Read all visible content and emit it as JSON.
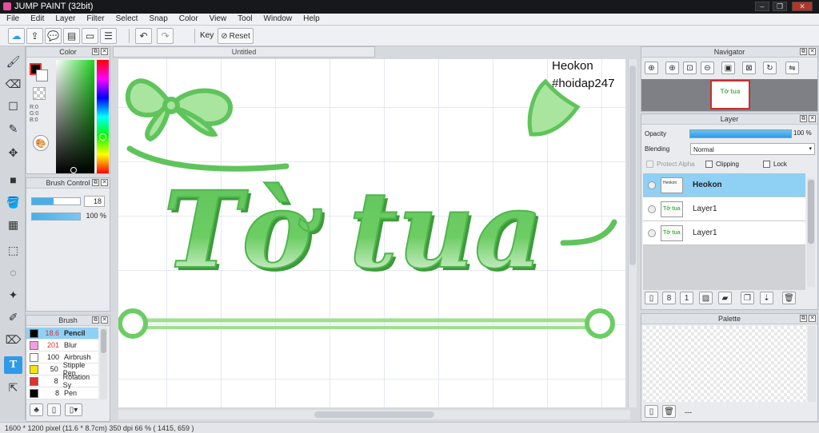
{
  "window": {
    "title": "JUMP PAINT (32bit)"
  },
  "menu": [
    "File",
    "Edit",
    "Layer",
    "Filter",
    "Select",
    "Snap",
    "Color",
    "View",
    "Tool",
    "Window",
    "Help"
  ],
  "toolbar": {
    "key_label": "Key",
    "reset_label": "Reset"
  },
  "document": {
    "tab_title": "Untitled"
  },
  "canvas_text": {
    "watermark_name": "Heokon",
    "watermark_tag": "#hoidap247",
    "art_text": "Tờ tua"
  },
  "color_panel": {
    "title": "Color",
    "r": "R:0",
    "g": "G:0",
    "b": "B:0"
  },
  "brush_control": {
    "title": "Brush Control",
    "size": "18",
    "opacity": "100 %"
  },
  "brush_panel": {
    "title": "Brush",
    "items": [
      {
        "size": "18.6",
        "name": "Pencil",
        "color": "#000000",
        "selected": true
      },
      {
        "size": "201",
        "name": "Blur",
        "color": "#f0a0e0",
        "selected": false
      },
      {
        "size": "100",
        "name": "Airbrush",
        "color": "#ffffff",
        "selected": false
      },
      {
        "size": "50",
        "name": "Stipple Pen",
        "color": "#f2e600",
        "selected": false
      },
      {
        "size": "8",
        "name": "Rotation Sy",
        "color": "#e03030",
        "selected": false
      },
      {
        "size": "8",
        "name": "Pen",
        "color": "#000000",
        "selected": false
      }
    ]
  },
  "navigator": {
    "title": "Navigator"
  },
  "layer_panel": {
    "title": "Layer",
    "opacity_label": "Opacity",
    "opacity_value": "100 %",
    "blending_label": "Blending",
    "blending_value": "Normal",
    "protect_alpha": "Protect Alpha",
    "clipping": "Clipping",
    "lock": "Lock",
    "layers": [
      {
        "name": "Heokon",
        "selected": true
      },
      {
        "name": "Layer1",
        "selected": false
      },
      {
        "name": "Layer1",
        "selected": false
      }
    ]
  },
  "palette": {
    "title": "Palette",
    "status": "---"
  },
  "status": {
    "info": "1600 * 1200 pixel   (11.6 * 8.7cm)   350 dpi   66 %   ( 1415, 659 )"
  },
  "colors": {
    "accent": "#2f9be8",
    "green": "#5fc45b",
    "green_light": "#a9e59e",
    "selected_layer": "#8fd0f5"
  }
}
